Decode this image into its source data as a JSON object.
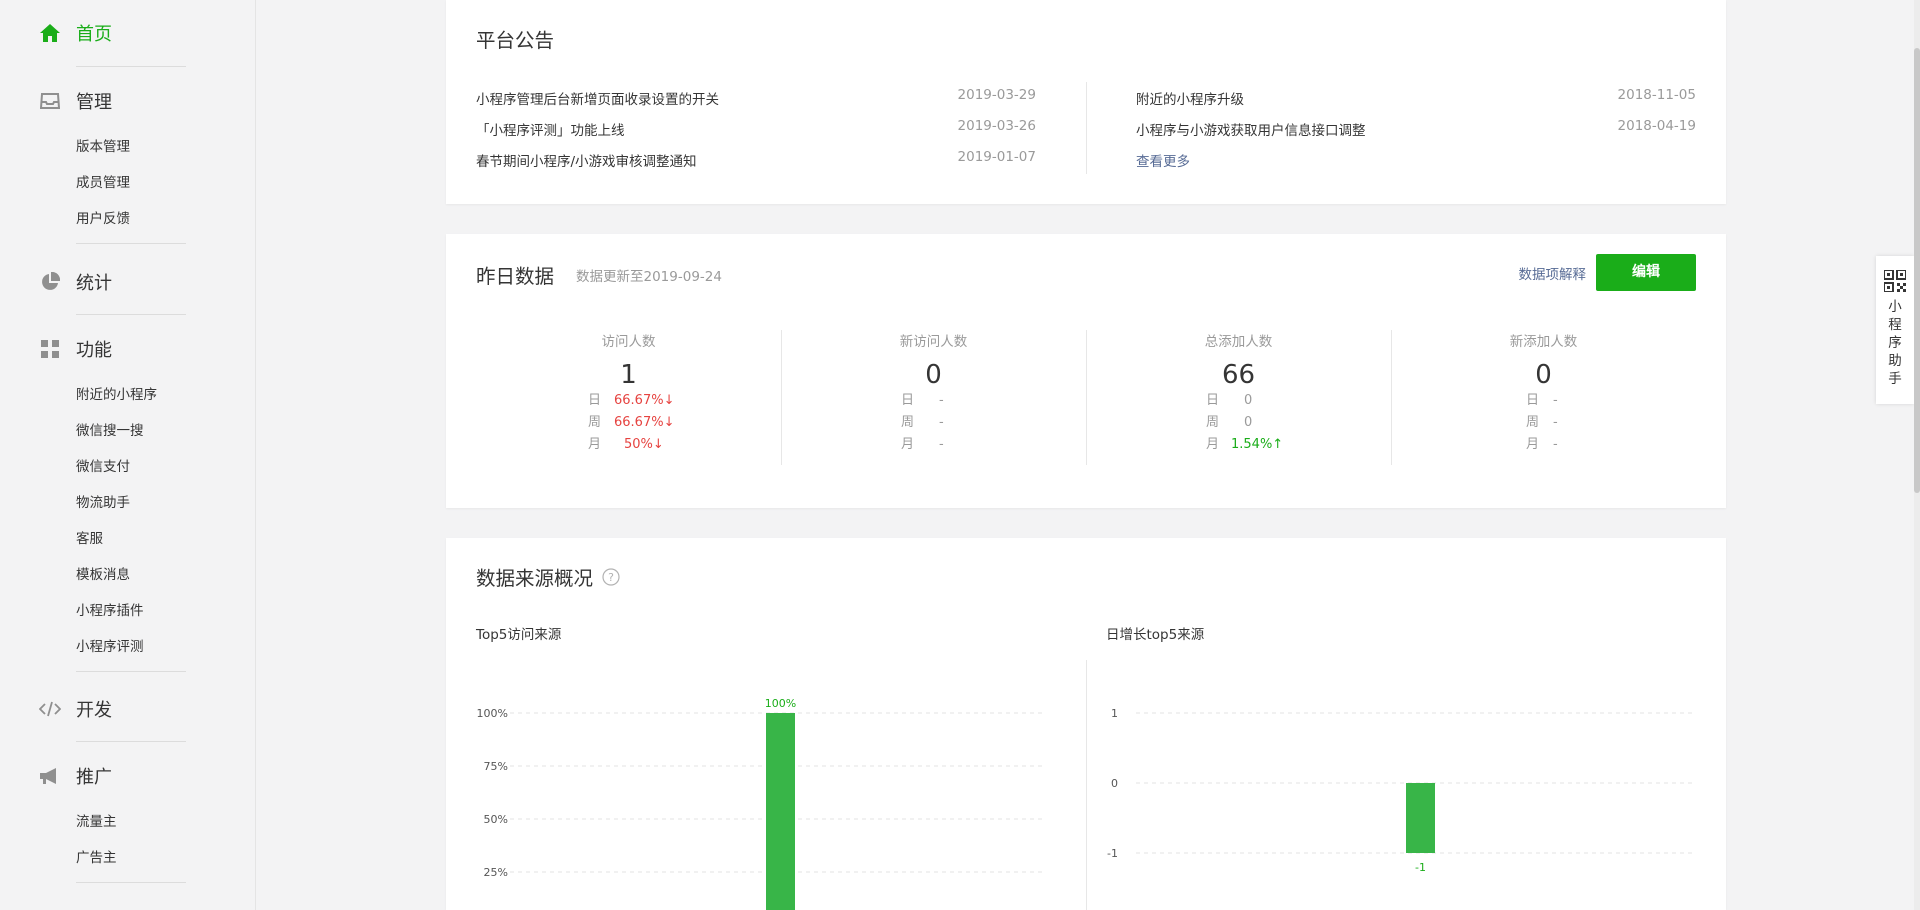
{
  "sidebar": {
    "home": "首页",
    "manage": {
      "label": "管理",
      "items": [
        "版本管理",
        "成员管理",
        "用户反馈"
      ]
    },
    "stats": {
      "label": "统计"
    },
    "features": {
      "label": "功能",
      "items": [
        "附近的小程序",
        "微信搜一搜",
        "微信支付",
        "物流助手",
        "客服",
        "模板消息",
        "小程序插件",
        "小程序评测"
      ]
    },
    "dev": {
      "label": "开发"
    },
    "promo": {
      "label": "推广",
      "items": [
        "流量主",
        "广告主"
      ]
    }
  },
  "announcements": {
    "title": "平台公告",
    "left": [
      {
        "text": "小程序管理后台新增页面收录设置的开关",
        "date": "2019-03-29"
      },
      {
        "text": "「小程序评测」功能上线",
        "date": "2019-03-26"
      },
      {
        "text": "春节期间小程序/小游戏审核调整通知",
        "date": "2019-01-07"
      }
    ],
    "right": [
      {
        "text": "附近的小程序升级",
        "date": "2018-11-05"
      },
      {
        "text": "小程序与小游戏获取用户信息接口调整",
        "date": "2018-04-19"
      }
    ],
    "more": "查看更多"
  },
  "yesterday": {
    "title": "昨日数据",
    "updated": "数据更新至2019-09-24",
    "explain_link": "数据项解释",
    "edit_button": "编辑",
    "stats": [
      {
        "label": "访问人数",
        "value": "1",
        "rows": [
          {
            "k": "日",
            "v": "66.67%↓",
            "trend": "down"
          },
          {
            "k": "周",
            "v": "66.67%↓",
            "trend": "down"
          },
          {
            "k": "月",
            "v": "50%↓",
            "trend": "down"
          }
        ]
      },
      {
        "label": "新访问人数",
        "value": "0",
        "rows": [
          {
            "k": "日",
            "v": "-",
            "trend": "none"
          },
          {
            "k": "周",
            "v": "-",
            "trend": "none"
          },
          {
            "k": "月",
            "v": "-",
            "trend": "none"
          }
        ]
      },
      {
        "label": "总添加人数",
        "value": "66",
        "rows": [
          {
            "k": "日",
            "v": "0",
            "trend": "none"
          },
          {
            "k": "周",
            "v": "0",
            "trend": "none"
          },
          {
            "k": "月",
            "v": "1.54%↑",
            "trend": "up"
          }
        ]
      },
      {
        "label": "新添加人数",
        "value": "0",
        "rows": [
          {
            "k": "日",
            "v": "-",
            "trend": "none"
          },
          {
            "k": "周",
            "v": "-",
            "trend": "none"
          },
          {
            "k": "月",
            "v": "-",
            "trend": "none"
          }
        ]
      }
    ]
  },
  "source": {
    "title": "数据来源概况",
    "help_icon": "question-circle-icon"
  },
  "helper": {
    "label": "小程序助手",
    "icon": "qr-code-icon"
  },
  "colors": {
    "accent": "#1aad19",
    "bar": "#38b548",
    "down": "#e64340",
    "link": "#576b95"
  },
  "chart_data": [
    {
      "type": "bar",
      "title": "Top5访问来源",
      "y_tick_labels": [
        "100%",
        "75%",
        "50%",
        "25%"
      ],
      "values": [
        100
      ],
      "data_labels": [
        "100%"
      ],
      "unit": "%",
      "ylim": [
        0,
        100
      ],
      "grid": true
    },
    {
      "type": "bar",
      "title": "日增长top5来源",
      "y_tick_labels": [
        "1",
        "0",
        "-1"
      ],
      "values": [
        -1
      ],
      "data_labels": [
        "-1"
      ],
      "ylim": [
        -1,
        1
      ],
      "grid": true
    }
  ]
}
